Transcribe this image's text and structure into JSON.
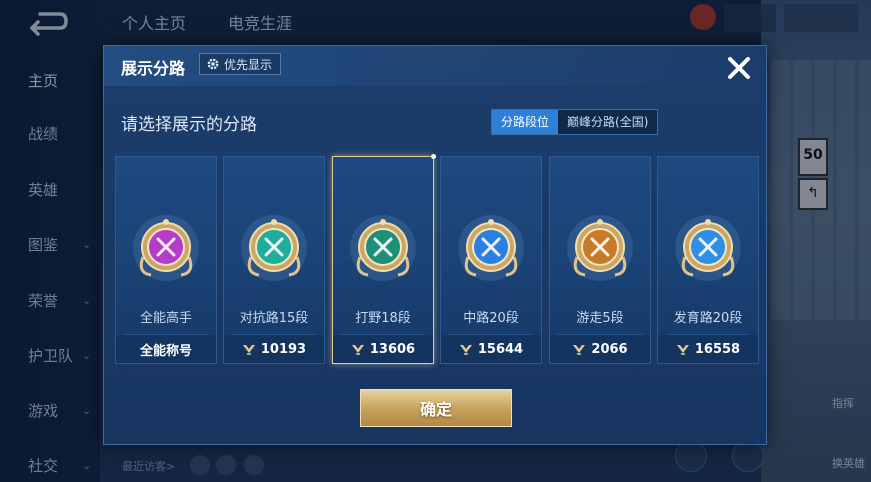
{
  "background": {
    "sidebar": {
      "items": [
        {
          "label": "主页",
          "active": true,
          "chevron": false
        },
        {
          "label": "战绩",
          "active": false,
          "chevron": false
        },
        {
          "label": "英雄",
          "active": false,
          "chevron": false
        },
        {
          "label": "图鉴",
          "active": false,
          "chevron": true
        },
        {
          "label": "荣誉",
          "active": false,
          "chevron": true
        },
        {
          "label": "护卫队",
          "active": false,
          "chevron": true
        },
        {
          "label": "游戏",
          "active": false,
          "chevron": true
        },
        {
          "label": "社交",
          "active": false,
          "chevron": true
        }
      ]
    },
    "top_tabs": [
      "个人主页",
      "电竞生涯"
    ],
    "recent_visitors_label": "最近访客>",
    "right_labels": [
      "指挥",
      "换英雄"
    ]
  },
  "modal": {
    "title": "展示分路",
    "priority_button": "优先显示",
    "prompt": "请选择展示的分路",
    "mode_tabs": [
      {
        "label": "分路段位",
        "active": true
      },
      {
        "label": "巅峰分路(全国)",
        "active": false
      }
    ],
    "cards": [
      {
        "title": "全能高手",
        "footer": "全能称号",
        "show_rank_icon": false,
        "selected": false,
        "badge_color": "#b43cc8",
        "badge_icon": "allround-badge-icon"
      },
      {
        "title": "对抗路15段",
        "footer": "10193",
        "show_rank_icon": true,
        "selected": false,
        "badge_color": "#1fae9b",
        "badge_icon": "clash-lane-badge-icon"
      },
      {
        "title": "打野18段",
        "footer": "13606",
        "show_rank_icon": true,
        "selected": true,
        "badge_color": "#1f8f7a",
        "badge_icon": "jungle-badge-icon"
      },
      {
        "title": "中路20段",
        "footer": "15644",
        "show_rank_icon": true,
        "selected": false,
        "badge_color": "#2c7fe0",
        "badge_icon": "mid-lane-badge-icon"
      },
      {
        "title": "游走5段",
        "footer": "2066",
        "show_rank_icon": true,
        "selected": false,
        "badge_color": "#c77b2a",
        "badge_icon": "roam-badge-icon"
      },
      {
        "title": "发育路20段",
        "footer": "16558",
        "show_rank_icon": true,
        "selected": false,
        "badge_color": "#2f8fe6",
        "badge_icon": "farm-lane-badge-icon"
      }
    ],
    "confirm_button": "确定"
  }
}
